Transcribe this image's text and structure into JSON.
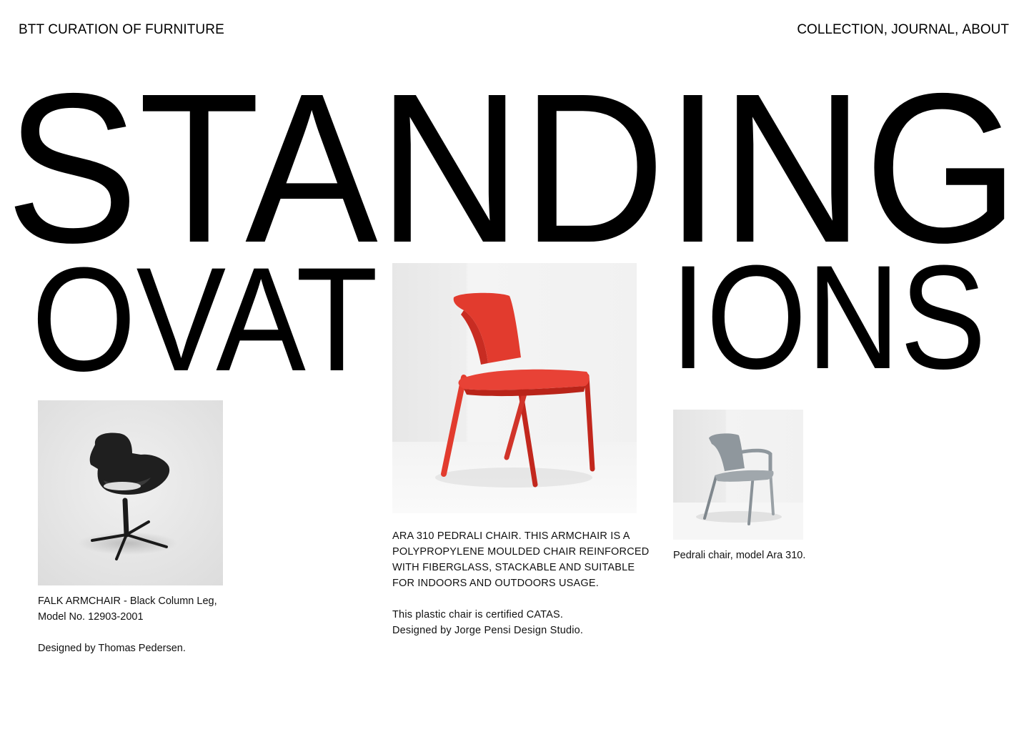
{
  "header": {
    "brand": "BTT CURATION OF FURNITURE",
    "nav": [
      {
        "label": "COLLECTION,"
      },
      {
        "label": "JOURNAL,"
      },
      {
        "label": "ABOUT"
      }
    ]
  },
  "hero": {
    "line1": "STANDING",
    "line2_left": "OVAT",
    "line2_right": "IONS"
  },
  "products": [
    {
      "caption_lines": [
        "FALK ARMCHAIR - Black Column Leg,",
        "Model No. 12903-2001"
      ],
      "designer": "Designed by Thomas Pedersen."
    },
    {
      "caption_lines": [
        "ARA 310 PEDRALI CHAIR. THIS ARMCHAIR IS A",
        "POLYPROPYLENE MOULDED CHAIR REINFORCED",
        "WITH FIBERGLASS, STACKABLE AND SUITABLE",
        "FOR INDOORS AND OUTDOORS USAGE."
      ],
      "extra_lines": [
        "This plastic chair is certified CATAS.",
        "Designed by Jorge Pensi Design Studio."
      ]
    },
    {
      "caption_lines": [
        "Pedrali chair, model Ara 310."
      ]
    }
  ],
  "colors": {
    "background": "#ffffff",
    "text": "#000000",
    "photo_bg_light": "#efefef",
    "chair_red": "#e23b2e",
    "chair_black": "#1c1c1c",
    "chair_grey": "#8f979d"
  }
}
